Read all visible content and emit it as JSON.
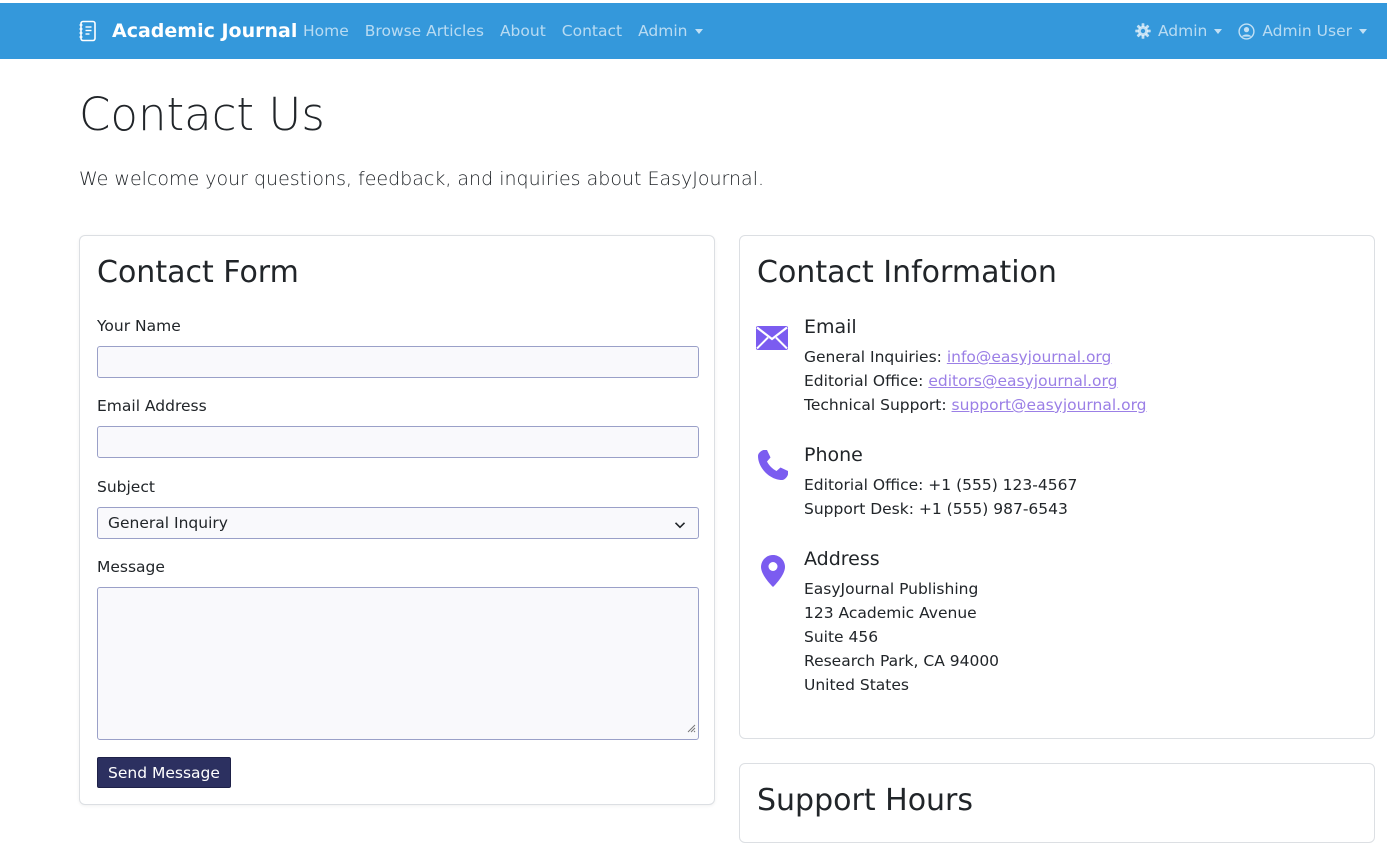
{
  "navbar": {
    "brand": "Academic Journal",
    "links": [
      "Home",
      "Browse Articles",
      "About",
      "Contact",
      "Admin"
    ],
    "right_admin": "Admin",
    "right_user": "Admin User",
    "bg_color": "#3498db"
  },
  "page": {
    "title": "Contact Us",
    "lead": "We welcome your questions, feedback, and inquiries about EasyJournal."
  },
  "contact_form": {
    "title": "Contact Form",
    "name_label": "Your Name",
    "name_value": "",
    "email_label": "Email Address",
    "email_value": "",
    "subject_label": "Subject",
    "subject_selected": "General Inquiry",
    "message_label": "Message",
    "message_value": "",
    "submit_label": "Send Message"
  },
  "contact_info": {
    "title": "Contact Information",
    "email": {
      "heading": "Email",
      "lines": [
        {
          "label": "General Inquiries: ",
          "link": "info@easyjournal.org"
        },
        {
          "label": "Editorial Office: ",
          "link": "editors@easyjournal.org"
        },
        {
          "label": "Technical Support: ",
          "link": "support@easyjournal.org"
        }
      ]
    },
    "phone": {
      "heading": "Phone",
      "lines": [
        "Editorial Office: +1 (555) 123-4567",
        "Support Desk: +1 (555) 987-6543"
      ]
    },
    "address": {
      "heading": "Address",
      "lines": [
        "EasyJournal Publishing",
        "123 Academic Avenue",
        "Suite 456",
        "Research Park, CA 94000",
        "United States"
      ]
    },
    "icon_color": "#7b5cf0"
  },
  "support_hours": {
    "title": "Support Hours"
  }
}
